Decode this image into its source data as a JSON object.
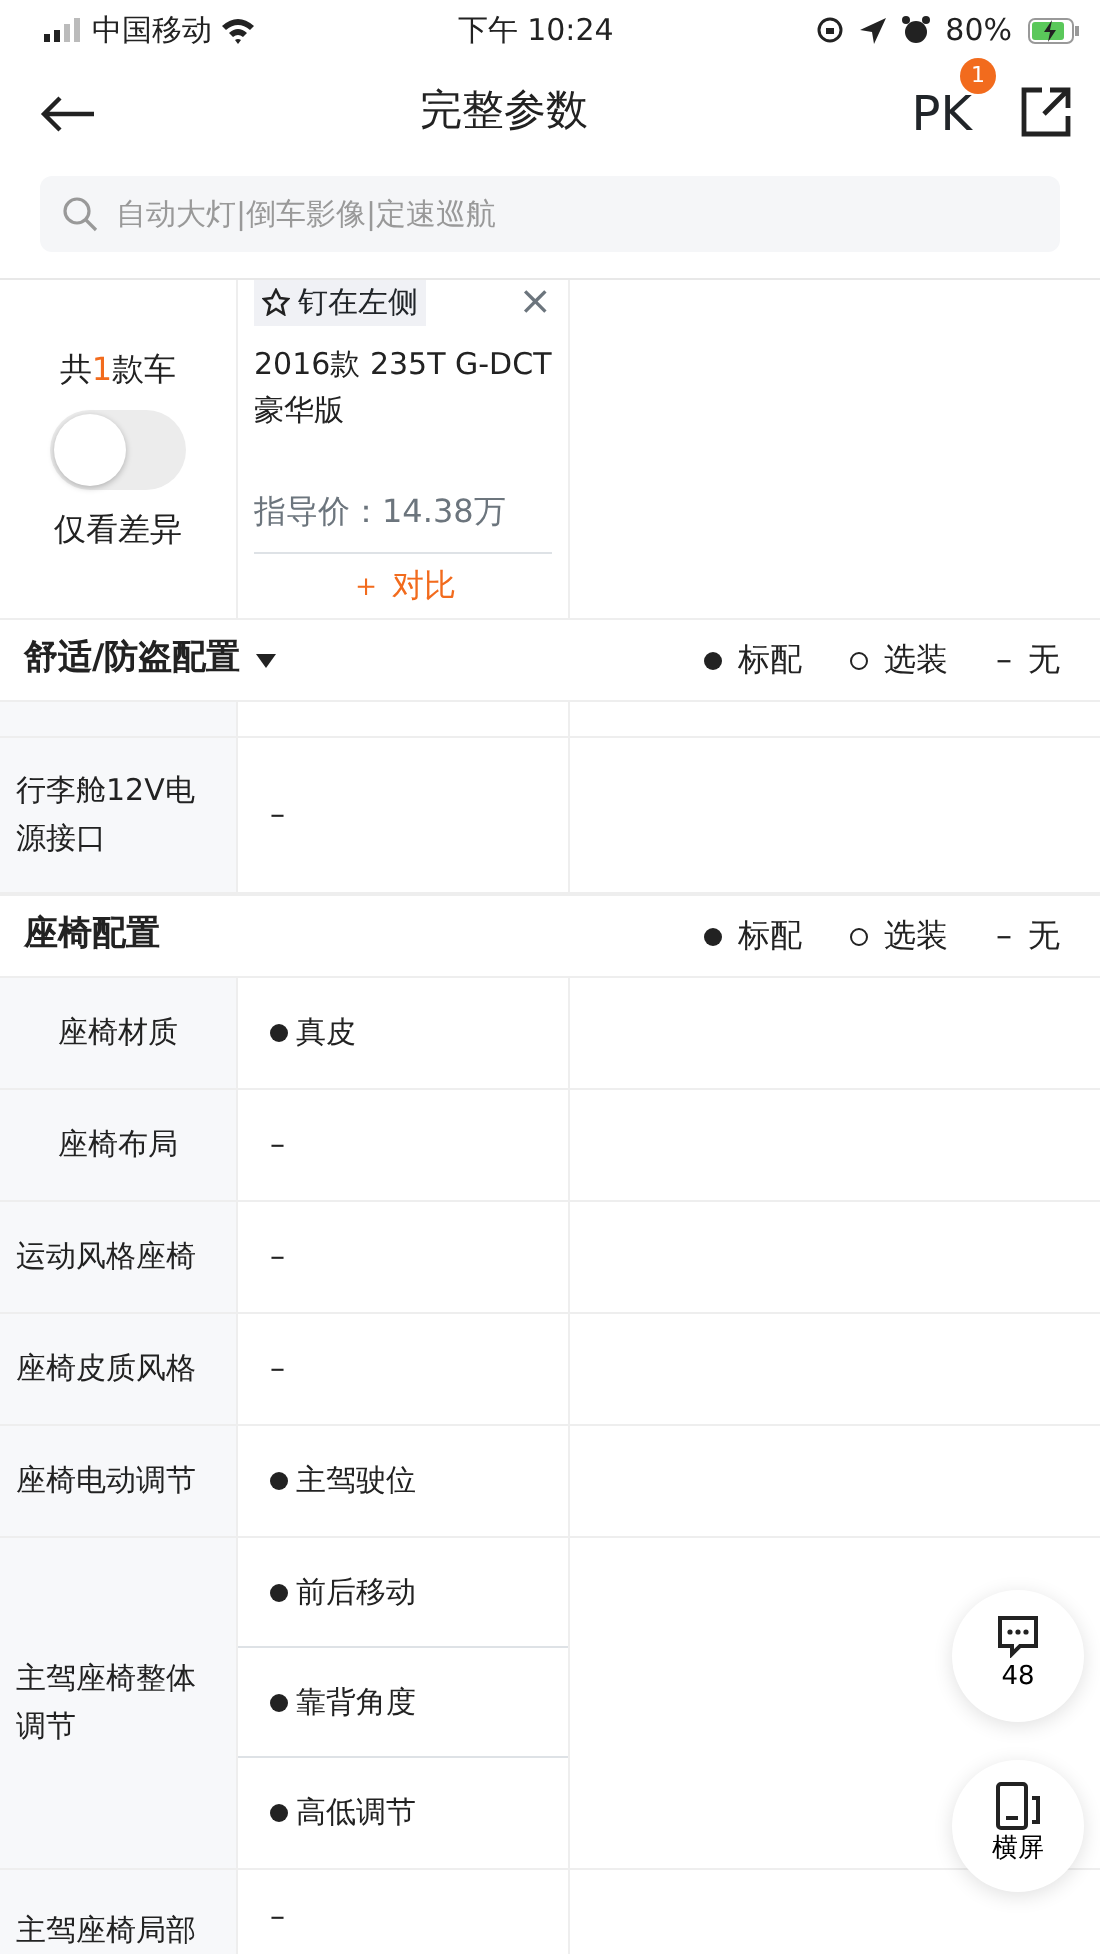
{
  "status_bar": {
    "carrier": "中国移动",
    "time": "下午 10:24",
    "battery": "80%"
  },
  "nav": {
    "title": "完整参数",
    "pk_label": "PK",
    "pk_badge": "1"
  },
  "search": {
    "placeholder": "自动大灯|倒车影像|定速巡航"
  },
  "summary": {
    "count_prefix": "共",
    "count": "1",
    "count_suffix": "款车",
    "diff_toggle": {
      "on": false,
      "label": "仅看差异"
    }
  },
  "cars": [
    {
      "pin_label": "钉在左侧",
      "close": "×",
      "name": "2016款 235T G-DCT豪华版",
      "price": "指导价：14.38万",
      "compare": "＋ 对比"
    }
  ],
  "sections": [
    {
      "title": "舒适/防盗配置",
      "expanded": true,
      "legend": [
        {
          "kind": "standard",
          "label": "标配"
        },
        {
          "kind": "optional",
          "label": "选装"
        },
        {
          "kind": "none",
          "symbol": "–",
          "label": "无"
        }
      ],
      "rows": [
        {
          "kind": "partial"
        },
        {
          "label": "行李舱12V电源接口",
          "values": [
            {
              "kind": "none",
              "text": "–"
            }
          ]
        }
      ]
    },
    {
      "title": "座椅配置",
      "legend": [
        {
          "kind": "standard",
          "label": "标配"
        },
        {
          "kind": "optional",
          "label": "选装"
        },
        {
          "kind": "none",
          "symbol": "–",
          "label": "无"
        }
      ],
      "rows": [
        {
          "label": "座椅材质",
          "values": [
            {
              "kind": "standard",
              "text": "真皮"
            }
          ]
        },
        {
          "label": "座椅布局",
          "values": [
            {
              "kind": "none",
              "text": "–"
            }
          ]
        },
        {
          "label": "运动风格座椅",
          "values": [
            {
              "kind": "none",
              "text": "–"
            }
          ]
        },
        {
          "label": "座椅皮质风格",
          "values": [
            {
              "kind": "none",
              "text": "–"
            }
          ]
        },
        {
          "label": "座椅电动调节",
          "values": [
            {
              "kind": "standard",
              "text": "主驾驶位"
            }
          ]
        },
        {
          "label": "主驾座椅整体调节",
          "values": [
            {
              "kind": "standard",
              "text": "前后移动"
            },
            {
              "kind": "standard",
              "text": "靠背角度"
            },
            {
              "kind": "standard",
              "text": "高低调节"
            }
          ]
        },
        {
          "label": "主驾座椅局部",
          "kind": "cut",
          "values": [
            {
              "kind": "none",
              "text": "–"
            }
          ]
        }
      ]
    }
  ],
  "floating": [
    {
      "kind": "comments",
      "label": "48"
    },
    {
      "kind": "landscape",
      "label": "横屏"
    }
  ]
}
